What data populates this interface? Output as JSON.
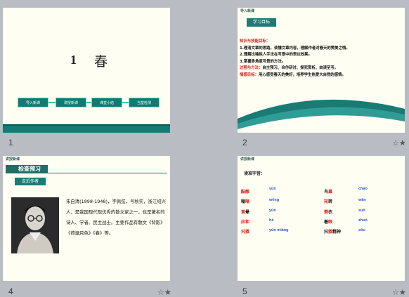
{
  "slide1": {
    "number": "1",
    "title_num": "1",
    "title_text": "春",
    "buttons": [
      "导入新课",
      "讲授新课",
      "课堂小结",
      "当堂检测"
    ]
  },
  "slide2": {
    "number": "2",
    "tag": "导入新课",
    "goal_label": "学习目标",
    "lines": [
      {
        "label": "知识与技能目标：",
        "text": ""
      },
      {
        "label": "",
        "text": "1.理清文章的思路，读懂文章内容，理解作者对春天的赞美之情。"
      },
      {
        "label": "",
        "text": "2.理解比喻拟人手法在写景中的表达效果。"
      },
      {
        "label": "",
        "text": "3.掌握多角度写景的方法。"
      },
      {
        "label": "过程与方法：",
        "text": "自主预习、合作研讨、探究赏析、由读至写。"
      },
      {
        "label": "情感目标：",
        "text": "用心感受春天的美好，培养学生热爱大自然的感情。"
      }
    ]
  },
  "slide4": {
    "number": "4",
    "tag": "讲授新课",
    "header": "检查预习",
    "author_label": "走近作者",
    "bio": "朱自清(1898-1948)，字佩弦，号秋实，浙江绍兴人，是我国现代现优秀的散文家之一，也是著名的诗人、学者、民主战士。主要作品有散文《背影》《荷塘月色》《春》等。"
  },
  "slide5": {
    "number": "5",
    "tag": "讲授新课",
    "lead": "读准字音：",
    "words": [
      {
        "w": "酝酿",
        "p": "yùn"
      },
      {
        "w": "嗡嗡",
        "p": "wēng"
      },
      {
        "w": "黄晕",
        "p": "yùn"
      },
      {
        "w": "应和",
        "p": "hè"
      },
      {
        "w": "抖擞精神",
        "p": "sǒu"
      },
      {
        "w": "鸟巢",
        "p": "cháo"
      },
      {
        "w": "宛转",
        "p": "wǎn"
      },
      {
        "w": "蓑衣",
        "p": "suō"
      },
      {
        "w": "着眼",
        "p": "zhuó"
      },
      {
        "w": "婉转精神",
        "p": "sǒu"
      }
    ]
  },
  "colors": {
    "teal": "#167a74",
    "red": "#e21d1d",
    "pinyin": "#2a55c8",
    "slide_bg": "#fffef3",
    "canvas": "#b9bcc3"
  },
  "icons": {
    "star": "star-icon"
  }
}
